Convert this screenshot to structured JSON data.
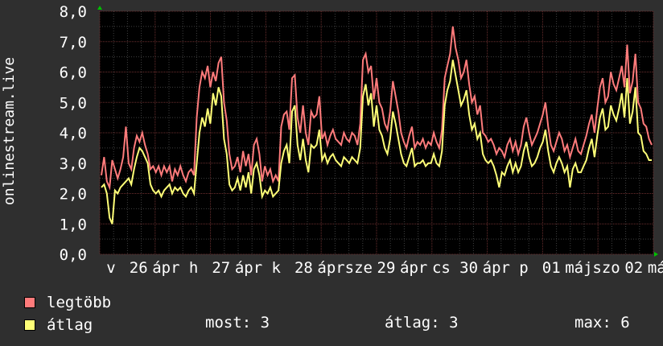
{
  "chart_data": {
    "type": "line",
    "ylabel": "onlinestream.live",
    "ylim": [
      0,
      8
    ],
    "yticks": [
      "0,0",
      "1,0",
      "2,0",
      "3,0",
      "4,0",
      "5,0",
      "6,0",
      "7,0",
      "8,0"
    ],
    "xtick_labels": [
      "v",
      "26",
      "ápr",
      "h",
      "27",
      "ápr",
      "k",
      "28",
      "ápr",
      "sze",
      "29",
      "ápr",
      "cs",
      "30",
      "ápr",
      "p",
      "01",
      "máj",
      "szo",
      "02",
      "máj"
    ],
    "grid": true,
    "legend_position": "bottom-left",
    "series": [
      {
        "name": "legtöbb",
        "color": "#ff7b7b",
        "values": [
          2.6,
          3.2,
          2.4,
          2.2,
          3.1,
          2.8,
          2.5,
          2.8,
          3.2,
          4.2,
          3.0,
          2.8,
          3.5,
          3.9,
          3.7,
          4.0,
          3.6,
          3.3,
          2.8,
          2.9,
          2.7,
          2.9,
          2.6,
          2.9,
          2.7,
          2.9,
          2.4,
          2.8,
          2.6,
          2.9,
          2.6,
          2.4,
          2.7,
          2.8,
          2.6,
          4.5,
          5.5,
          6.0,
          5.8,
          6.2,
          5.5,
          6.0,
          5.7,
          6.3,
          6.5,
          5.0,
          4.4,
          3.3,
          2.8,
          2.9,
          3.2,
          2.7,
          3.4,
          2.9,
          3.3,
          2.6,
          3.6,
          3.8,
          3.3,
          2.4,
          2.9,
          2.6,
          2.8,
          2.4,
          2.6,
          2.4,
          4.2,
          4.6,
          4.7,
          4.1,
          5.8,
          5.9,
          4.5,
          4.0,
          4.9,
          4.0,
          3.6,
          4.7,
          4.5,
          4.6,
          5.2,
          3.8,
          4.0,
          3.6,
          3.9,
          4.1,
          3.8,
          3.7,
          3.6,
          4.0,
          3.8,
          3.7,
          4.0,
          3.9,
          3.6,
          4.3,
          6.4,
          6.6,
          6.0,
          6.2,
          5.1,
          5.8,
          5.0,
          4.8,
          4.3,
          4.1,
          4.7,
          5.7,
          5.2,
          4.7,
          4.0,
          3.7,
          3.5,
          3.9,
          4.2,
          3.5,
          3.7,
          3.6,
          3.8,
          3.5,
          3.7,
          3.6,
          4.0,
          3.7,
          3.5,
          4.1,
          5.8,
          6.2,
          6.6,
          7.5,
          6.8,
          6.4,
          5.8,
          6.0,
          6.4,
          5.6,
          5.0,
          5.2,
          4.6,
          4.9,
          4.0,
          3.9,
          3.7,
          3.8,
          3.6,
          3.3,
          3.5,
          3.4,
          3.2,
          3.6,
          3.8,
          3.4,
          3.7,
          3.3,
          3.6,
          4.2,
          4.5,
          4.0,
          3.6,
          3.8,
          4.0,
          4.3,
          4.6,
          5.0,
          4.2,
          3.6,
          3.4,
          3.7,
          4.0,
          3.8,
          3.4,
          3.6,
          3.2,
          3.5,
          3.8,
          3.4,
          3.3,
          3.6,
          3.9,
          4.3,
          4.6,
          4.0,
          4.8,
          5.5,
          5.8,
          5.0,
          5.2,
          6.0,
          5.6,
          5.4,
          5.8,
          6.2,
          5.5,
          6.9,
          5.3,
          5.7,
          6.6,
          5.0,
          4.8,
          4.3,
          4.2,
          3.8,
          3.6
        ]
      },
      {
        "name": "átlag",
        "color": "#ffff77",
        "values": [
          2.2,
          2.3,
          2.0,
          1.2,
          1.0,
          2.1,
          2.0,
          2.2,
          2.3,
          2.4,
          2.5,
          2.3,
          2.8,
          3.2,
          3.5,
          3.4,
          3.2,
          3.0,
          2.3,
          2.1,
          2.0,
          2.1,
          1.9,
          2.1,
          2.2,
          2.3,
          2.0,
          2.2,
          2.1,
          2.2,
          2.0,
          1.9,
          2.1,
          2.2,
          2.0,
          3.0,
          4.0,
          4.5,
          4.2,
          4.8,
          4.3,
          5.3,
          4.9,
          5.5,
          5.2,
          3.8,
          3.3,
          2.3,
          2.1,
          2.2,
          2.5,
          2.1,
          2.6,
          2.2,
          2.7,
          2.0,
          2.8,
          3.0,
          2.6,
          1.9,
          2.1,
          2.0,
          2.2,
          1.9,
          2.0,
          2.1,
          3.0,
          3.4,
          3.6,
          3.0,
          4.7,
          4.9,
          3.6,
          3.1,
          3.8,
          3.1,
          2.7,
          3.6,
          3.5,
          3.6,
          4.1,
          3.1,
          3.3,
          3.0,
          3.2,
          3.3,
          3.1,
          3.0,
          2.9,
          3.2,
          3.1,
          3.0,
          3.2,
          3.1,
          3.0,
          3.5,
          5.2,
          5.6,
          4.9,
          5.3,
          4.2,
          4.9,
          4.1,
          3.9,
          3.5,
          3.3,
          3.8,
          4.7,
          4.3,
          3.8,
          3.3,
          3.0,
          2.9,
          3.2,
          3.5,
          2.9,
          3.0,
          3.0,
          3.1,
          2.9,
          3.0,
          3.0,
          3.3,
          3.0,
          2.9,
          3.4,
          4.9,
          5.4,
          5.7,
          6.4,
          5.9,
          5.4,
          4.9,
          5.1,
          5.4,
          4.6,
          4.1,
          4.3,
          3.8,
          4.0,
          3.3,
          3.1,
          3.0,
          3.1,
          2.9,
          2.6,
          2.2,
          2.7,
          2.6,
          2.9,
          3.1,
          2.7,
          3.0,
          2.7,
          2.9,
          3.4,
          3.7,
          3.2,
          2.9,
          3.0,
          3.2,
          3.5,
          3.7,
          4.1,
          3.4,
          2.9,
          2.7,
          3.0,
          3.2,
          3.0,
          2.7,
          2.9,
          2.2,
          2.8,
          3.0,
          2.7,
          2.7,
          2.9,
          3.1,
          3.5,
          3.8,
          3.2,
          3.9,
          4.5,
          4.8,
          4.1,
          4.2,
          4.9,
          4.6,
          4.4,
          4.8,
          5.3,
          4.5,
          5.8,
          4.3,
          4.7,
          5.5,
          4.0,
          3.9,
          3.4,
          3.3,
          3.1,
          3.1
        ]
      }
    ]
  },
  "legend": [
    {
      "label": "legtöbb",
      "color": "#ff7b7b"
    },
    {
      "label": "átlag",
      "color": "#ffff77"
    }
  ],
  "stats": {
    "current": "most: 3",
    "average": "átlag: 3",
    "max": "max: 6"
  },
  "colors": {
    "background": "#2f2f2f",
    "plot_background": "#000000",
    "grid_minor": "#404040",
    "grid_major": "#6a2e2e",
    "axis_arrow": "#00c000"
  }
}
